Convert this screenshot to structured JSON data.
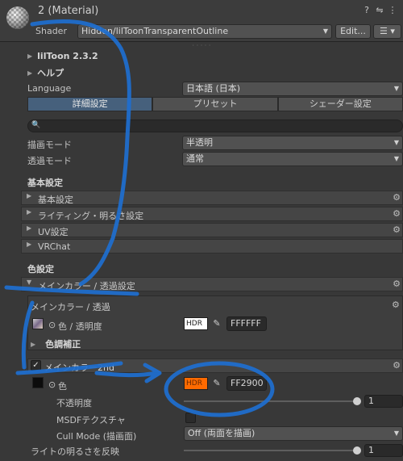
{
  "header": {
    "title": "2 (Material)",
    "shader_label": "Shader",
    "shader_value": "Hidden/lilToonTransparentOutline",
    "edit_button": "Edit...",
    "icons": [
      "help-icon",
      "preset-icon",
      "more-icon",
      "list-icon"
    ]
  },
  "foldouts": {
    "liltoon": "lilToon 2.3.2",
    "help": "ヘルプ"
  },
  "language": {
    "label": "Language",
    "value": "日本語 (日本)"
  },
  "tabs": [
    "詳細設定",
    "プリセット",
    "シェーダー設定"
  ],
  "render": {
    "mode_label": "描画モード",
    "mode_value": "半透明",
    "transparent_label": "透過モード",
    "transparent_value": "通常"
  },
  "basic_section": {
    "title": "基本設定",
    "items": [
      "基本設定",
      "ライティング・明るさ設定",
      "UV設定",
      "VRChat"
    ]
  },
  "color_section": {
    "title": "色設定",
    "main_header": "メインカラー / 透過設定",
    "sub_header": "メインカラー / 透過",
    "color_label": "色 / 透明度",
    "color_hdr": "HDR",
    "color_hex": "FFFFFF",
    "correction_label": "色調補正"
  },
  "main2": {
    "header": "メインカラー2nd",
    "enabled": true,
    "color_label": "色",
    "color_hdr": "HDR",
    "color_hex": "FF2900",
    "swatch_color": "#FF6A00",
    "opacity_label": "不透明度",
    "opacity_value": "1",
    "opacity_fraction": 1.0,
    "msdf_label": "MSDFテクスチャ",
    "cull_label": "Cull Mode (描画面)",
    "cull_value": "Off (両面を描画)",
    "light_label": "ライトの明るさを反映",
    "light_value": "1",
    "light_fraction": 1.0
  },
  "colors": {
    "accent_tab": "#46607C",
    "annotation": "#1E6FD0"
  }
}
